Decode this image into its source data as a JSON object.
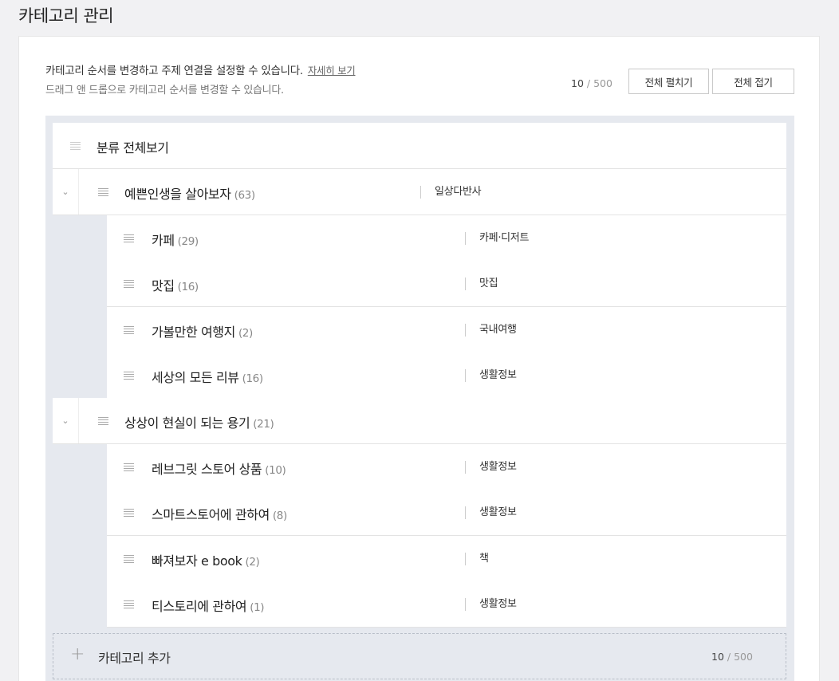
{
  "page": {
    "title": "카테고리 관리"
  },
  "header": {
    "description": "카테고리 순서를 변경하고 주제 연결을 설정할 수 있습니다.",
    "detail_link": "자세히 보기",
    "drag_hint": "드래그 앤 드롭으로 카테고리 순서를 변경할 수 있습니다.",
    "count": "10",
    "count_max": "/ 500",
    "expand_all": "전체 펼치기",
    "collapse_all": "전체 접기"
  },
  "tree": {
    "root": {
      "label": "분류 전체보기"
    },
    "groups": [
      {
        "name": "예쁜인생을 살아보자",
        "count": "(63)",
        "topic": "일상다반사",
        "toggle": "⌄",
        "children": [
          {
            "name": "카페",
            "count": "(29)",
            "topic": "카페·디저트"
          },
          {
            "name": "맛집",
            "count": "(16)",
            "topic": "맛집"
          },
          {
            "name": "가볼만한 여행지",
            "count": "(2)",
            "topic": "국내여행"
          },
          {
            "name": "세상의 모든 리뷰",
            "count": "(16)",
            "topic": "생활정보"
          }
        ]
      },
      {
        "name": "상상이 현실이 되는 용기",
        "count": "(21)",
        "topic": "",
        "toggle": "⌄",
        "children": [
          {
            "name": "레브그릿 스토어 상품",
            "count": "(10)",
            "topic": "생활정보"
          },
          {
            "name": "스마트스토어에 관하여",
            "count": "(8)",
            "topic": "생활정보"
          },
          {
            "name": "빠져보자 e book",
            "count": "(2)",
            "topic": "책"
          },
          {
            "name": "티스토리에 관하여",
            "count": "(1)",
            "topic": "생활정보"
          }
        ]
      }
    ]
  },
  "add_category": {
    "icon": "plus-icon",
    "plus_glyph": "+",
    "label": "카테고리 추가",
    "count": "10",
    "count_max": "/ 500"
  }
}
